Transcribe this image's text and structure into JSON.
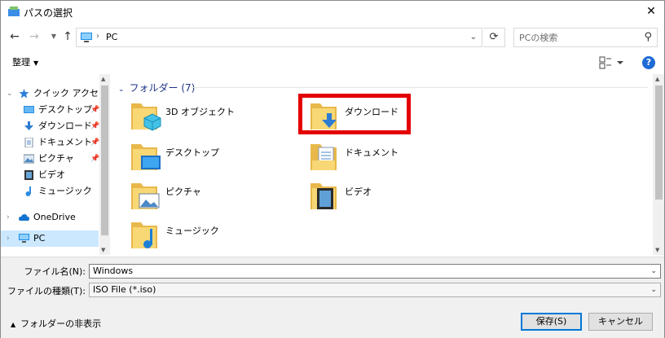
{
  "window": {
    "title": "パスの選択"
  },
  "address": {
    "location": "PC"
  },
  "search": {
    "placeholder": "PCの検索"
  },
  "toolbar": {
    "organize_label": "整理"
  },
  "nav": {
    "items": [
      {
        "label": "クイック アクセス",
        "icon": "star-icon"
      },
      {
        "label": "デスクトップ",
        "icon": "desktop-icon"
      },
      {
        "label": "ダウンロード",
        "icon": "download-icon"
      },
      {
        "label": "ドキュメント",
        "icon": "document-icon"
      },
      {
        "label": "ピクチャ",
        "icon": "picture-icon"
      },
      {
        "label": "ビデオ",
        "icon": "video-icon"
      },
      {
        "label": "ミュージック",
        "icon": "music-icon"
      },
      {
        "label": "OneDrive",
        "icon": "cloud-icon"
      },
      {
        "label": "PC",
        "icon": "pc-icon"
      }
    ]
  },
  "content": {
    "group_label": "フォルダー (7)",
    "folders": [
      {
        "label": "3D オブジェクト",
        "icon": "3d-objects-folder-icon"
      },
      {
        "label": "ダウンロード",
        "icon": "downloads-folder-icon"
      },
      {
        "label": "デスクトップ",
        "icon": "desktop-folder-icon"
      },
      {
        "label": "ドキュメント",
        "icon": "documents-folder-icon"
      },
      {
        "label": "ピクチャ",
        "icon": "pictures-folder-icon"
      },
      {
        "label": "ビデオ",
        "icon": "videos-folder-icon"
      },
      {
        "label": "ミュージック",
        "icon": "music-folder-icon"
      }
    ]
  },
  "form": {
    "filename_label": "ファイル名(N):",
    "filename_value": "Windows",
    "filetype_label": "ファイルの種類(T):",
    "filetype_value": "ISO File (*.iso)"
  },
  "footer": {
    "hide_folders_label": "フォルダーの非表示",
    "save_label": "保存(S)",
    "cancel_label": "キャンセル"
  },
  "colors": {
    "highlight_border": "#e30000",
    "accent": "#0078d7",
    "group_header": "#1e3287",
    "selection": "#cce8ff",
    "folder": "#f8d775"
  }
}
